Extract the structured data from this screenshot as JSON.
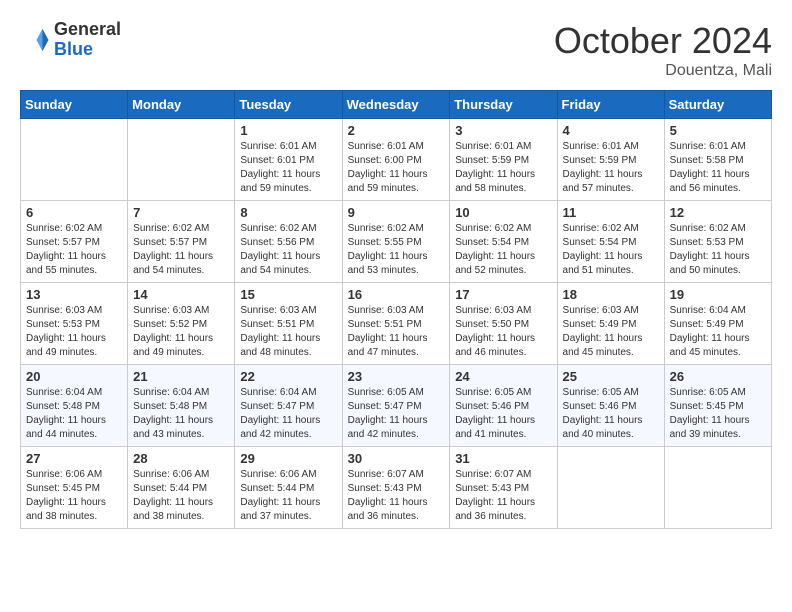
{
  "header": {
    "logo_line1": "General",
    "logo_line2": "Blue",
    "month": "October 2024",
    "location": "Douentza, Mali"
  },
  "days_of_week": [
    "Sunday",
    "Monday",
    "Tuesday",
    "Wednesday",
    "Thursday",
    "Friday",
    "Saturday"
  ],
  "weeks": [
    [
      {
        "day": "",
        "sunrise": "",
        "sunset": "",
        "daylight": ""
      },
      {
        "day": "",
        "sunrise": "",
        "sunset": "",
        "daylight": ""
      },
      {
        "day": "1",
        "sunrise": "Sunrise: 6:01 AM",
        "sunset": "Sunset: 6:01 PM",
        "daylight": "Daylight: 11 hours and 59 minutes."
      },
      {
        "day": "2",
        "sunrise": "Sunrise: 6:01 AM",
        "sunset": "Sunset: 6:00 PM",
        "daylight": "Daylight: 11 hours and 59 minutes."
      },
      {
        "day": "3",
        "sunrise": "Sunrise: 6:01 AM",
        "sunset": "Sunset: 5:59 PM",
        "daylight": "Daylight: 11 hours and 58 minutes."
      },
      {
        "day": "4",
        "sunrise": "Sunrise: 6:01 AM",
        "sunset": "Sunset: 5:59 PM",
        "daylight": "Daylight: 11 hours and 57 minutes."
      },
      {
        "day": "5",
        "sunrise": "Sunrise: 6:01 AM",
        "sunset": "Sunset: 5:58 PM",
        "daylight": "Daylight: 11 hours and 56 minutes."
      }
    ],
    [
      {
        "day": "6",
        "sunrise": "Sunrise: 6:02 AM",
        "sunset": "Sunset: 5:57 PM",
        "daylight": "Daylight: 11 hours and 55 minutes."
      },
      {
        "day": "7",
        "sunrise": "Sunrise: 6:02 AM",
        "sunset": "Sunset: 5:57 PM",
        "daylight": "Daylight: 11 hours and 54 minutes."
      },
      {
        "day": "8",
        "sunrise": "Sunrise: 6:02 AM",
        "sunset": "Sunset: 5:56 PM",
        "daylight": "Daylight: 11 hours and 54 minutes."
      },
      {
        "day": "9",
        "sunrise": "Sunrise: 6:02 AM",
        "sunset": "Sunset: 5:55 PM",
        "daylight": "Daylight: 11 hours and 53 minutes."
      },
      {
        "day": "10",
        "sunrise": "Sunrise: 6:02 AM",
        "sunset": "Sunset: 5:54 PM",
        "daylight": "Daylight: 11 hours and 52 minutes."
      },
      {
        "day": "11",
        "sunrise": "Sunrise: 6:02 AM",
        "sunset": "Sunset: 5:54 PM",
        "daylight": "Daylight: 11 hours and 51 minutes."
      },
      {
        "day": "12",
        "sunrise": "Sunrise: 6:02 AM",
        "sunset": "Sunset: 5:53 PM",
        "daylight": "Daylight: 11 hours and 50 minutes."
      }
    ],
    [
      {
        "day": "13",
        "sunrise": "Sunrise: 6:03 AM",
        "sunset": "Sunset: 5:53 PM",
        "daylight": "Daylight: 11 hours and 49 minutes."
      },
      {
        "day": "14",
        "sunrise": "Sunrise: 6:03 AM",
        "sunset": "Sunset: 5:52 PM",
        "daylight": "Daylight: 11 hours and 49 minutes."
      },
      {
        "day": "15",
        "sunrise": "Sunrise: 6:03 AM",
        "sunset": "Sunset: 5:51 PM",
        "daylight": "Daylight: 11 hours and 48 minutes."
      },
      {
        "day": "16",
        "sunrise": "Sunrise: 6:03 AM",
        "sunset": "Sunset: 5:51 PM",
        "daylight": "Daylight: 11 hours and 47 minutes."
      },
      {
        "day": "17",
        "sunrise": "Sunrise: 6:03 AM",
        "sunset": "Sunset: 5:50 PM",
        "daylight": "Daylight: 11 hours and 46 minutes."
      },
      {
        "day": "18",
        "sunrise": "Sunrise: 6:03 AM",
        "sunset": "Sunset: 5:49 PM",
        "daylight": "Daylight: 11 hours and 45 minutes."
      },
      {
        "day": "19",
        "sunrise": "Sunrise: 6:04 AM",
        "sunset": "Sunset: 5:49 PM",
        "daylight": "Daylight: 11 hours and 45 minutes."
      }
    ],
    [
      {
        "day": "20",
        "sunrise": "Sunrise: 6:04 AM",
        "sunset": "Sunset: 5:48 PM",
        "daylight": "Daylight: 11 hours and 44 minutes."
      },
      {
        "day": "21",
        "sunrise": "Sunrise: 6:04 AM",
        "sunset": "Sunset: 5:48 PM",
        "daylight": "Daylight: 11 hours and 43 minutes."
      },
      {
        "day": "22",
        "sunrise": "Sunrise: 6:04 AM",
        "sunset": "Sunset: 5:47 PM",
        "daylight": "Daylight: 11 hours and 42 minutes."
      },
      {
        "day": "23",
        "sunrise": "Sunrise: 6:05 AM",
        "sunset": "Sunset: 5:47 PM",
        "daylight": "Daylight: 11 hours and 42 minutes."
      },
      {
        "day": "24",
        "sunrise": "Sunrise: 6:05 AM",
        "sunset": "Sunset: 5:46 PM",
        "daylight": "Daylight: 11 hours and 41 minutes."
      },
      {
        "day": "25",
        "sunrise": "Sunrise: 6:05 AM",
        "sunset": "Sunset: 5:46 PM",
        "daylight": "Daylight: 11 hours and 40 minutes."
      },
      {
        "day": "26",
        "sunrise": "Sunrise: 6:05 AM",
        "sunset": "Sunset: 5:45 PM",
        "daylight": "Daylight: 11 hours and 39 minutes."
      }
    ],
    [
      {
        "day": "27",
        "sunrise": "Sunrise: 6:06 AM",
        "sunset": "Sunset: 5:45 PM",
        "daylight": "Daylight: 11 hours and 38 minutes."
      },
      {
        "day": "28",
        "sunrise": "Sunrise: 6:06 AM",
        "sunset": "Sunset: 5:44 PM",
        "daylight": "Daylight: 11 hours and 38 minutes."
      },
      {
        "day": "29",
        "sunrise": "Sunrise: 6:06 AM",
        "sunset": "Sunset: 5:44 PM",
        "daylight": "Daylight: 11 hours and 37 minutes."
      },
      {
        "day": "30",
        "sunrise": "Sunrise: 6:07 AM",
        "sunset": "Sunset: 5:43 PM",
        "daylight": "Daylight: 11 hours and 36 minutes."
      },
      {
        "day": "31",
        "sunrise": "Sunrise: 6:07 AM",
        "sunset": "Sunset: 5:43 PM",
        "daylight": "Daylight: 11 hours and 36 minutes."
      },
      {
        "day": "",
        "sunrise": "",
        "sunset": "",
        "daylight": ""
      },
      {
        "day": "",
        "sunrise": "",
        "sunset": "",
        "daylight": ""
      }
    ]
  ]
}
